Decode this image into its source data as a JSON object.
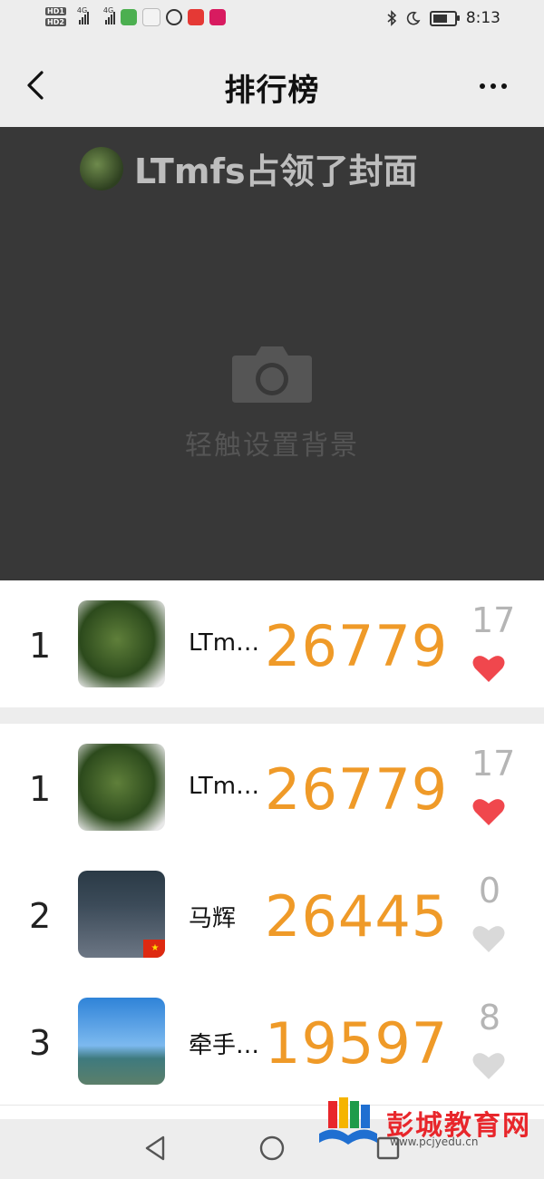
{
  "status_bar": {
    "sim1_label": "HD",
    "sim1_sub": "1",
    "sim2_label": "HD",
    "sim2_sub": "2",
    "net1": "4G",
    "net2": "4G",
    "time": "8:13",
    "battery_level": 0.7
  },
  "header": {
    "title": "排行榜"
  },
  "cover": {
    "owner_text": "LTmfs占领了封面",
    "hint": "轻触设置背景"
  },
  "my_rank": {
    "rank": "1",
    "name": "LTm…",
    "steps": "26779",
    "likes": "17",
    "liked": true
  },
  "leaderboard": [
    {
      "rank": "1",
      "name": "LTm…",
      "steps": "26779",
      "likes": "17",
      "liked": true
    },
    {
      "rank": "2",
      "name": "马辉",
      "steps": "26445",
      "likes": "0",
      "liked": false
    },
    {
      "rank": "3",
      "name": "牵手…",
      "steps": "19597",
      "likes": "8",
      "liked": false
    }
  ],
  "watermark": {
    "title": "彭城教育网",
    "url": "www.pcjyedu.cn"
  },
  "colors": {
    "steps": "#ef9a28",
    "heart_active": "#f0474d",
    "heart_inactive": "#d9d9d9",
    "cover_bg": "#383838"
  }
}
